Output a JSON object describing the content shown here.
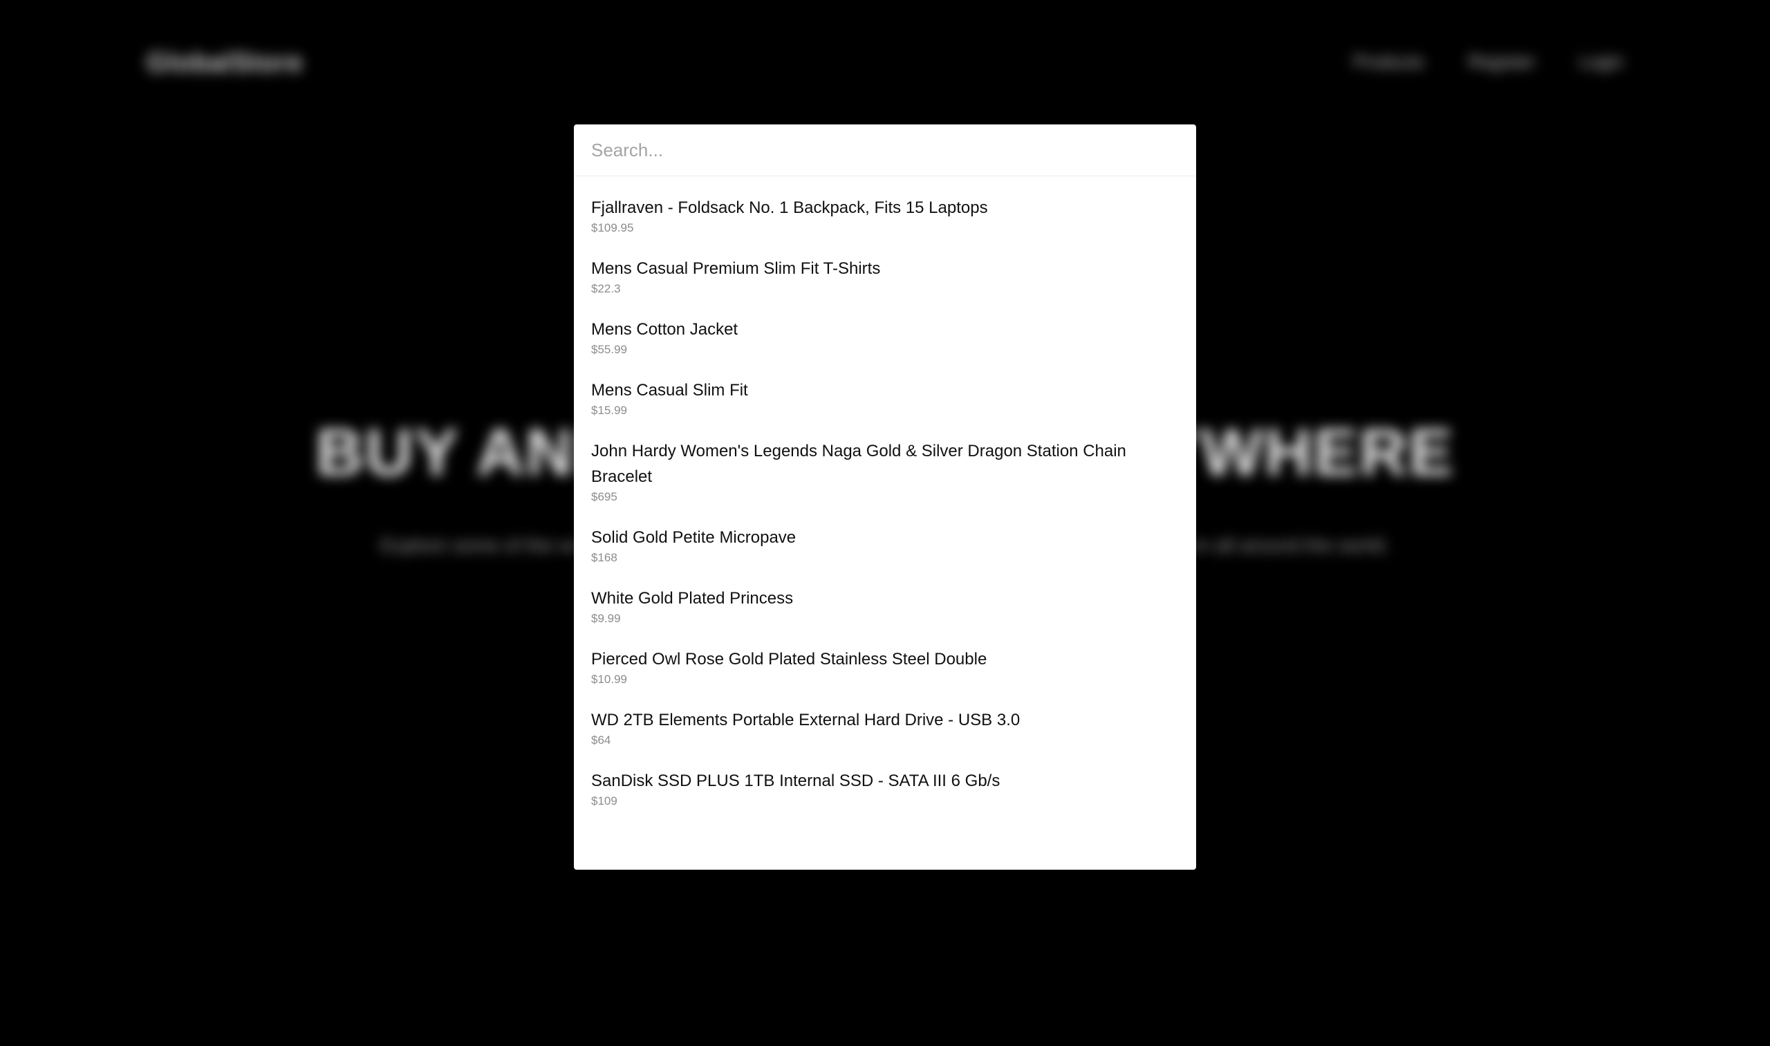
{
  "site": {
    "logo": "GlobalStore",
    "nav": [
      "Products",
      "Register",
      "Login"
    ],
    "hero_title": "BUY AND SELL FROM ANYWHERE",
    "hero_subtitle": "Explore some of the world's finest products from our partners and connecting the best finest from all around the world."
  },
  "search": {
    "placeholder": "Search..."
  },
  "results": [
    {
      "title": "Fjallraven - Foldsack No. 1 Backpack, Fits 15 Laptops",
      "price": "$109.95"
    },
    {
      "title": "Mens Casual Premium Slim Fit T-Shirts",
      "price": "$22.3"
    },
    {
      "title": "Mens Cotton Jacket",
      "price": "$55.99"
    },
    {
      "title": "Mens Casual Slim Fit",
      "price": "$15.99"
    },
    {
      "title": "John Hardy Women's Legends Naga Gold & Silver Dragon Station Chain Bracelet",
      "price": "$695"
    },
    {
      "title": "Solid Gold Petite Micropave",
      "price": "$168"
    },
    {
      "title": "White Gold Plated Princess",
      "price": "$9.99"
    },
    {
      "title": "Pierced Owl Rose Gold Plated Stainless Steel Double",
      "price": "$10.99"
    },
    {
      "title": "WD 2TB Elements Portable External Hard Drive - USB 3.0",
      "price": "$64"
    },
    {
      "title": "SanDisk SSD PLUS 1TB Internal SSD - SATA III 6 Gb/s",
      "price": "$109"
    }
  ]
}
